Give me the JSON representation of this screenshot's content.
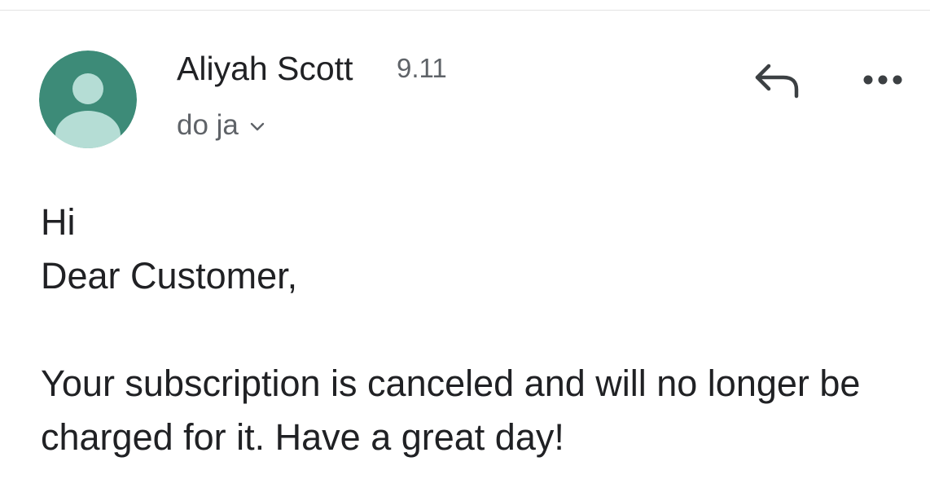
{
  "email": {
    "sender_name": "Aliyah Scott",
    "date": "9.11",
    "recipient_label": "do ja",
    "greeting": "Hi",
    "salutation": "Dear Customer,",
    "body": "Your subscription is canceled and will no longer be charged for it. Have a great day!"
  },
  "icons": {
    "avatar": "person-avatar-icon",
    "recipient_toggle": "chevron-down-icon",
    "reply": "reply-arrow-icon",
    "more": "more-horizontal-icon"
  },
  "colors": {
    "avatar_background": "#3d8b78",
    "avatar_figure": "#b5ddd5",
    "primary_text": "#202124",
    "secondary_text": "#5f6368"
  }
}
